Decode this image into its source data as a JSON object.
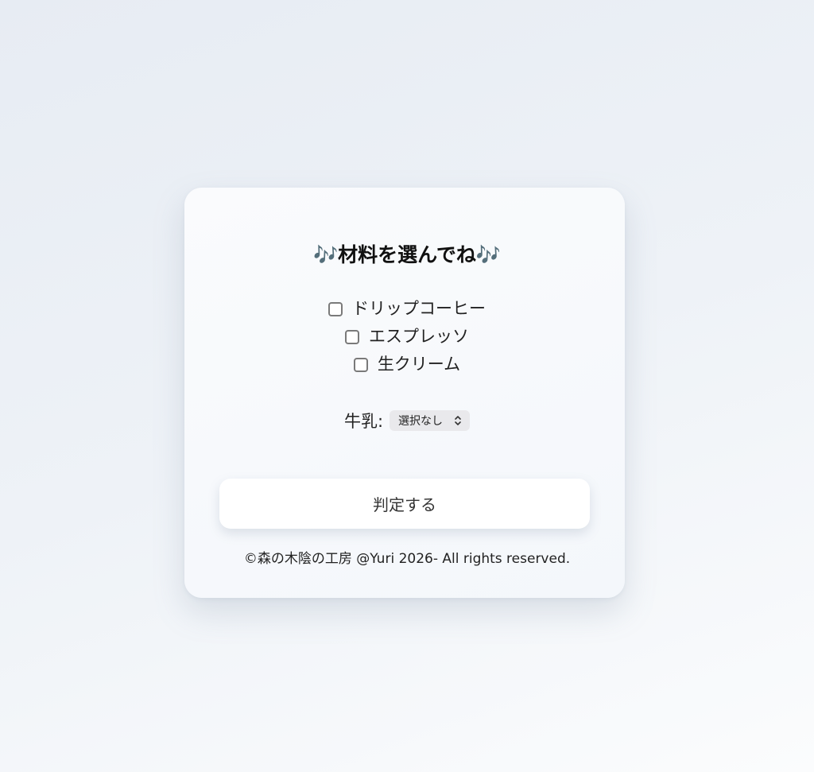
{
  "title": "🎶材料を選んでね🎶",
  "ingredients": [
    {
      "label": "ドリップコーヒー",
      "checked": false
    },
    {
      "label": "エスプレッソ",
      "checked": false
    },
    {
      "label": "生クリーム",
      "checked": false
    }
  ],
  "milk": {
    "label": "牛乳:",
    "selected": "選択なし"
  },
  "submit_label": "判定する",
  "footer": "©森の木陰の工房 @Yuri 2026- All rights reserved.",
  "icons": {
    "select_arrow": "chevron-up-down-icon"
  },
  "colors": {
    "card_bg": "#f7f9fc",
    "button_bg": "#ffffff",
    "select_bg": "#e9e9ec"
  }
}
